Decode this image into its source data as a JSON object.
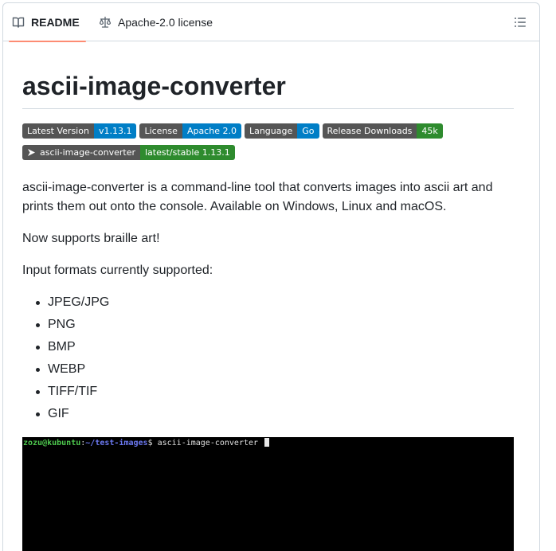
{
  "tabs": {
    "readme_label": "README",
    "license_label": "Apache-2.0 license"
  },
  "readme": {
    "title": "ascii-image-converter",
    "badges_row1": [
      {
        "label": "Latest Version",
        "value": "v1.13.1",
        "color": "#007ec6"
      },
      {
        "label": "License",
        "value": "Apache 2.0",
        "color": "#007ec6"
      },
      {
        "label": "Language",
        "value": "Go",
        "color": "#007ec6"
      },
      {
        "label": "Release Downloads",
        "value": "45k",
        "color": "#2e8b2e"
      }
    ],
    "badges_row2": [
      {
        "label": "ascii-image-converter",
        "value": "latest/stable 1.13.1",
        "color": "#2e8b2e",
        "icon": "snap-arrow-icon"
      }
    ],
    "description": "ascii-image-converter is a command-line tool that converts images into ascii art and prints them out onto the console. Available on Windows, Linux and macOS.",
    "braille_note": "Now supports braille art!",
    "formats_heading": "Input formats currently supported:",
    "formats": [
      "JPEG/JPG",
      "PNG",
      "BMP",
      "WEBP",
      "TIFF/TIF",
      "GIF"
    ],
    "terminal": {
      "user_host": "zozu@kubuntu",
      "path": "~/test-images",
      "prompt_tail": "$ ascii-image-converter "
    }
  },
  "icons": {
    "readme": "book-icon",
    "license": "law-scale-icon",
    "outline": "list-unordered-icon"
  }
}
